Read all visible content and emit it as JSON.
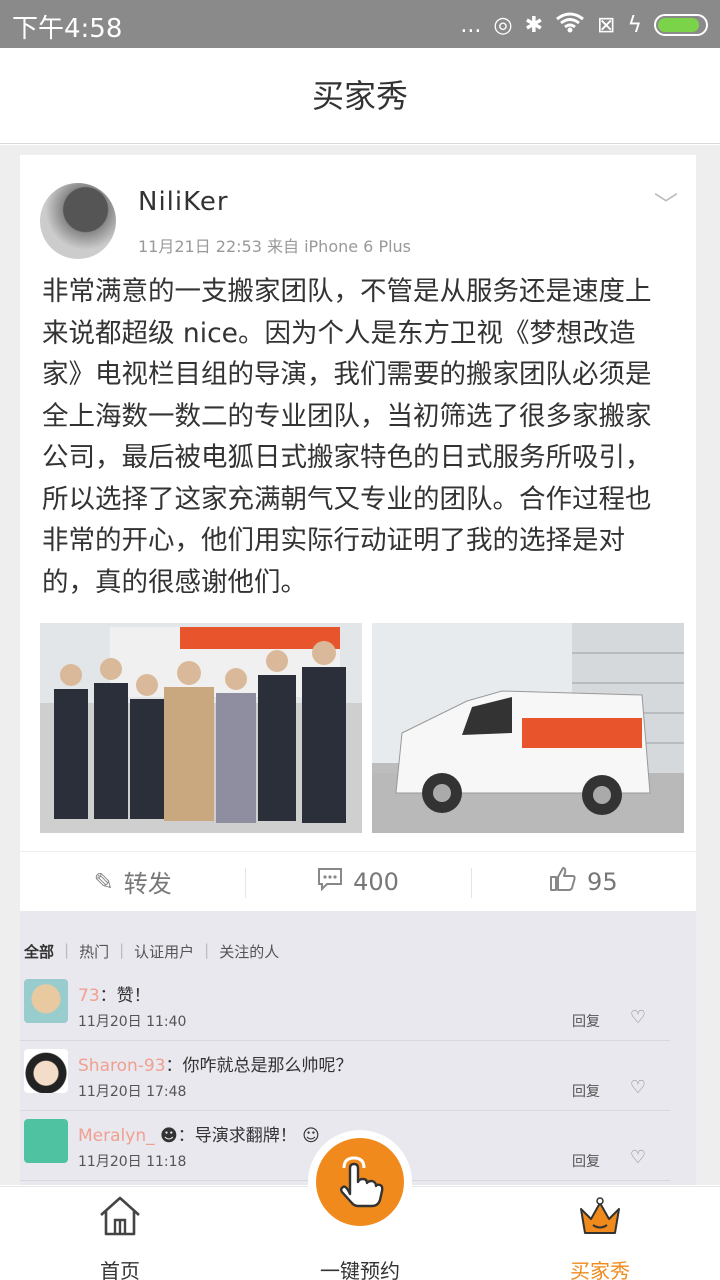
{
  "status_bar": {
    "time": "下午4:58",
    "more": "...",
    "battery_level": 0.9
  },
  "header": {
    "title": "买家秀"
  },
  "post": {
    "username": "NiliKer",
    "meta": "11月21日 22:53 来自 iPhone 6 Plus",
    "text": "非常满意的一支搬家团队，不管是从服务还是速度上来说都超级 nice。因为个人是东方卫视《梦想改造家》电视栏目组的导演，我们需要的搬家团队必须是全上海数一数二的专业团队，当初筛选了很多家搬家公司，最后被电狐日式搬家特色的日式服务所吸引，所以选择了这家充满朝气又专业的团队。合作过程也非常的开心，他们用实际行动证明了我的选择是对的，真的很感谢他们。",
    "actions": {
      "repost_label": "转发",
      "comment_count": "400",
      "like_count": "95"
    }
  },
  "comments": {
    "tabs": [
      "全部",
      "热门",
      "认证用户",
      "关注的人"
    ],
    "items": [
      {
        "nick": "73",
        "text": "：赞！",
        "time": "11月20日 11:40",
        "reply": "回复"
      },
      {
        "nick": "Sharon-93",
        "text": "：你咋就总是那么帅呢？",
        "time": "11月20日 17:48",
        "reply": "回复"
      },
      {
        "nick": "Meralyn_",
        "text": "：导演求翻牌！",
        "time": "11月20日 11:18",
        "reply": "回复"
      }
    ]
  },
  "tabbar": {
    "home": "首页",
    "book": "一键预约",
    "show": "买家秀"
  },
  "colors": {
    "accent": "#f08a1c",
    "status_bar": "#8a8a8a"
  }
}
